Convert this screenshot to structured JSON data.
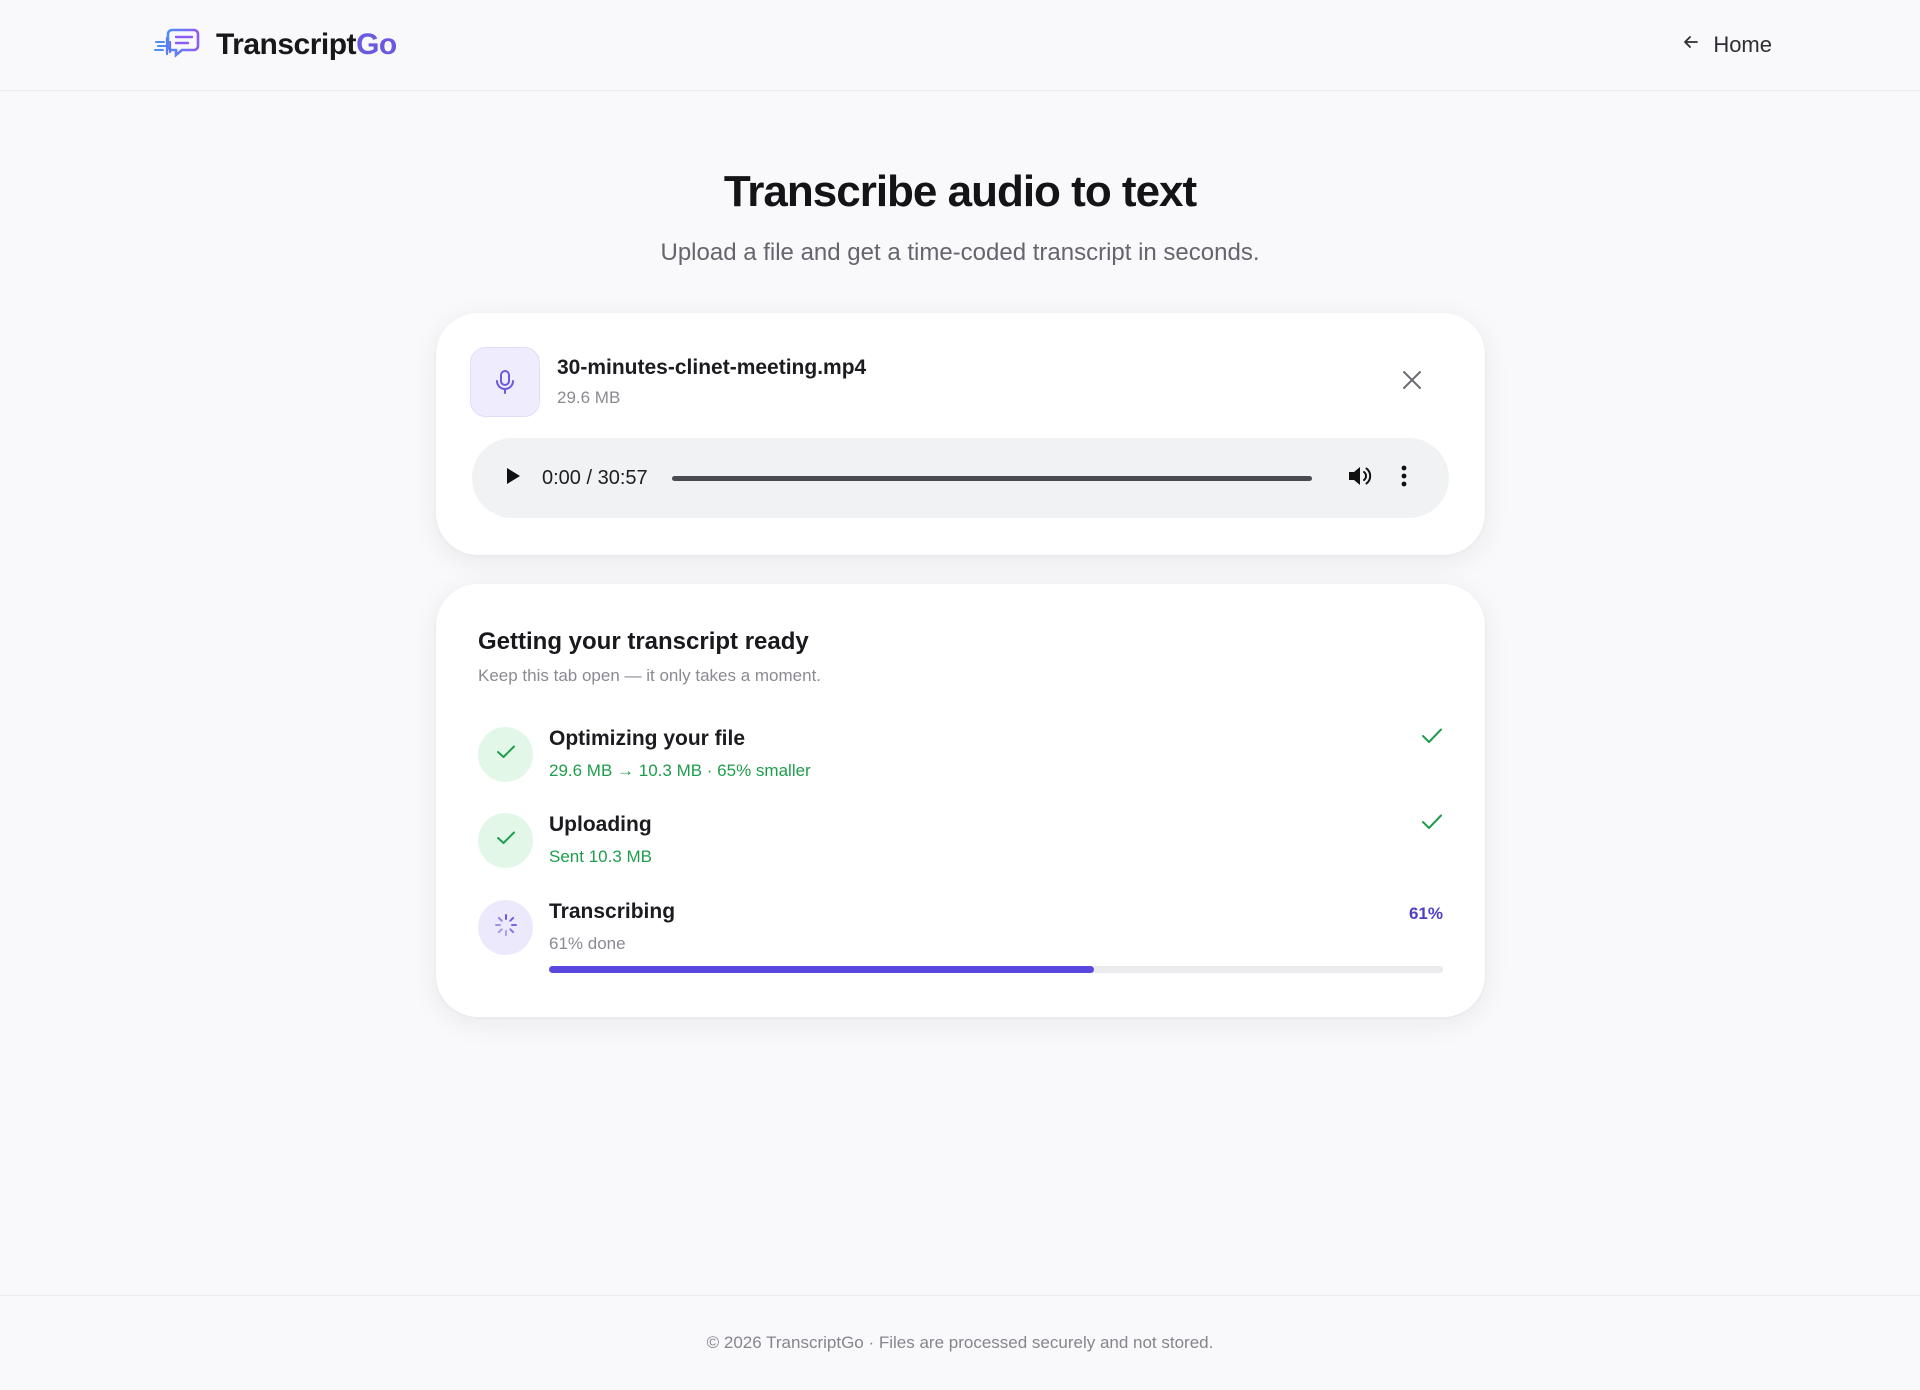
{
  "brand": {
    "name_main": "Transcript",
    "name_accent": "Go",
    "accent_color": "#6a5ae0"
  },
  "nav": {
    "home_label": "Home"
  },
  "hero": {
    "title": "Transcribe audio to text",
    "subtitle": "Upload a file and get a time-coded transcript in seconds."
  },
  "file": {
    "name": "30-minutes-clinet-meeting.mp4",
    "size": "29.6 MB"
  },
  "player": {
    "time": "0:00 / 30:57",
    "progress": 0
  },
  "progress": {
    "title": "Getting your transcript ready",
    "subtitle": "Keep this tab open — it only takes a moment.",
    "steps": [
      {
        "title": "Optimizing your file",
        "detail": "29.6 MB → 10.3 MB · 65% smaller",
        "status": "done"
      },
      {
        "title": "Uploading",
        "detail": "Sent 10.3 MB",
        "status": "done"
      },
      {
        "title": "Transcribing",
        "detail": "61% done",
        "status": "active",
        "percent_label": "61%",
        "percent": 61
      }
    ]
  },
  "footer": {
    "text": "© 2026 TranscriptGo · Files are processed securely and not stored."
  },
  "colors": {
    "success": "#1f9d4c",
    "accent": "#5a48de"
  }
}
